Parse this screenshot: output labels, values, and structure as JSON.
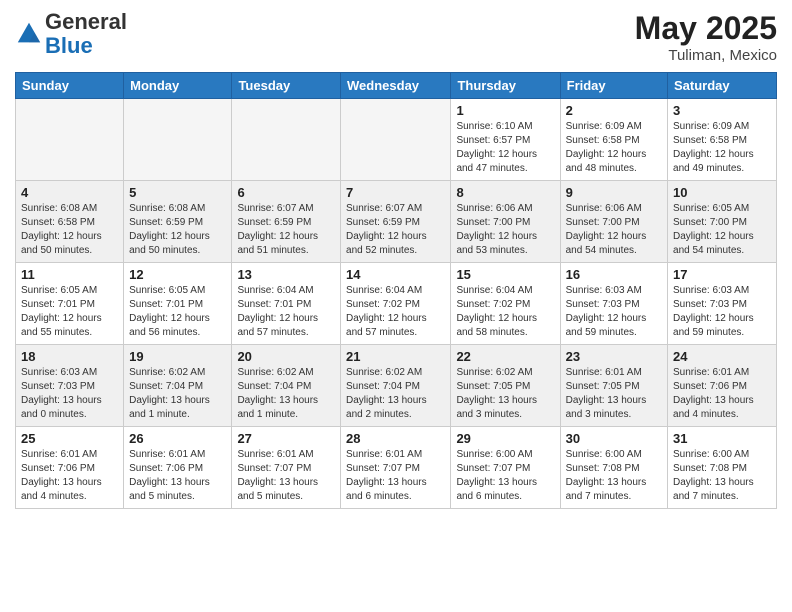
{
  "header": {
    "logo_general": "General",
    "logo_blue": "Blue",
    "month_year": "May 2025",
    "location": "Tuliman, Mexico"
  },
  "weekdays": [
    "Sunday",
    "Monday",
    "Tuesday",
    "Wednesday",
    "Thursday",
    "Friday",
    "Saturday"
  ],
  "weeks": [
    [
      {
        "day": "",
        "info": ""
      },
      {
        "day": "",
        "info": ""
      },
      {
        "day": "",
        "info": ""
      },
      {
        "day": "",
        "info": ""
      },
      {
        "day": "1",
        "info": "Sunrise: 6:10 AM\nSunset: 6:57 PM\nDaylight: 12 hours\nand 47 minutes."
      },
      {
        "day": "2",
        "info": "Sunrise: 6:09 AM\nSunset: 6:58 PM\nDaylight: 12 hours\nand 48 minutes."
      },
      {
        "day": "3",
        "info": "Sunrise: 6:09 AM\nSunset: 6:58 PM\nDaylight: 12 hours\nand 49 minutes."
      }
    ],
    [
      {
        "day": "4",
        "info": "Sunrise: 6:08 AM\nSunset: 6:58 PM\nDaylight: 12 hours\nand 50 minutes."
      },
      {
        "day": "5",
        "info": "Sunrise: 6:08 AM\nSunset: 6:59 PM\nDaylight: 12 hours\nand 50 minutes."
      },
      {
        "day": "6",
        "info": "Sunrise: 6:07 AM\nSunset: 6:59 PM\nDaylight: 12 hours\nand 51 minutes."
      },
      {
        "day": "7",
        "info": "Sunrise: 6:07 AM\nSunset: 6:59 PM\nDaylight: 12 hours\nand 52 minutes."
      },
      {
        "day": "8",
        "info": "Sunrise: 6:06 AM\nSunset: 7:00 PM\nDaylight: 12 hours\nand 53 minutes."
      },
      {
        "day": "9",
        "info": "Sunrise: 6:06 AM\nSunset: 7:00 PM\nDaylight: 12 hours\nand 54 minutes."
      },
      {
        "day": "10",
        "info": "Sunrise: 6:05 AM\nSunset: 7:00 PM\nDaylight: 12 hours\nand 54 minutes."
      }
    ],
    [
      {
        "day": "11",
        "info": "Sunrise: 6:05 AM\nSunset: 7:01 PM\nDaylight: 12 hours\nand 55 minutes."
      },
      {
        "day": "12",
        "info": "Sunrise: 6:05 AM\nSunset: 7:01 PM\nDaylight: 12 hours\nand 56 minutes."
      },
      {
        "day": "13",
        "info": "Sunrise: 6:04 AM\nSunset: 7:01 PM\nDaylight: 12 hours\nand 57 minutes."
      },
      {
        "day": "14",
        "info": "Sunrise: 6:04 AM\nSunset: 7:02 PM\nDaylight: 12 hours\nand 57 minutes."
      },
      {
        "day": "15",
        "info": "Sunrise: 6:04 AM\nSunset: 7:02 PM\nDaylight: 12 hours\nand 58 minutes."
      },
      {
        "day": "16",
        "info": "Sunrise: 6:03 AM\nSunset: 7:03 PM\nDaylight: 12 hours\nand 59 minutes."
      },
      {
        "day": "17",
        "info": "Sunrise: 6:03 AM\nSunset: 7:03 PM\nDaylight: 12 hours\nand 59 minutes."
      }
    ],
    [
      {
        "day": "18",
        "info": "Sunrise: 6:03 AM\nSunset: 7:03 PM\nDaylight: 13 hours\nand 0 minutes."
      },
      {
        "day": "19",
        "info": "Sunrise: 6:02 AM\nSunset: 7:04 PM\nDaylight: 13 hours\nand 1 minute."
      },
      {
        "day": "20",
        "info": "Sunrise: 6:02 AM\nSunset: 7:04 PM\nDaylight: 13 hours\nand 1 minute."
      },
      {
        "day": "21",
        "info": "Sunrise: 6:02 AM\nSunset: 7:04 PM\nDaylight: 13 hours\nand 2 minutes."
      },
      {
        "day": "22",
        "info": "Sunrise: 6:02 AM\nSunset: 7:05 PM\nDaylight: 13 hours\nand 3 minutes."
      },
      {
        "day": "23",
        "info": "Sunrise: 6:01 AM\nSunset: 7:05 PM\nDaylight: 13 hours\nand 3 minutes."
      },
      {
        "day": "24",
        "info": "Sunrise: 6:01 AM\nSunset: 7:06 PM\nDaylight: 13 hours\nand 4 minutes."
      }
    ],
    [
      {
        "day": "25",
        "info": "Sunrise: 6:01 AM\nSunset: 7:06 PM\nDaylight: 13 hours\nand 4 minutes."
      },
      {
        "day": "26",
        "info": "Sunrise: 6:01 AM\nSunset: 7:06 PM\nDaylight: 13 hours\nand 5 minutes."
      },
      {
        "day": "27",
        "info": "Sunrise: 6:01 AM\nSunset: 7:07 PM\nDaylight: 13 hours\nand 5 minutes."
      },
      {
        "day": "28",
        "info": "Sunrise: 6:01 AM\nSunset: 7:07 PM\nDaylight: 13 hours\nand 6 minutes."
      },
      {
        "day": "29",
        "info": "Sunrise: 6:00 AM\nSunset: 7:07 PM\nDaylight: 13 hours\nand 6 minutes."
      },
      {
        "day": "30",
        "info": "Sunrise: 6:00 AM\nSunset: 7:08 PM\nDaylight: 13 hours\nand 7 minutes."
      },
      {
        "day": "31",
        "info": "Sunrise: 6:00 AM\nSunset: 7:08 PM\nDaylight: 13 hours\nand 7 minutes."
      }
    ]
  ]
}
